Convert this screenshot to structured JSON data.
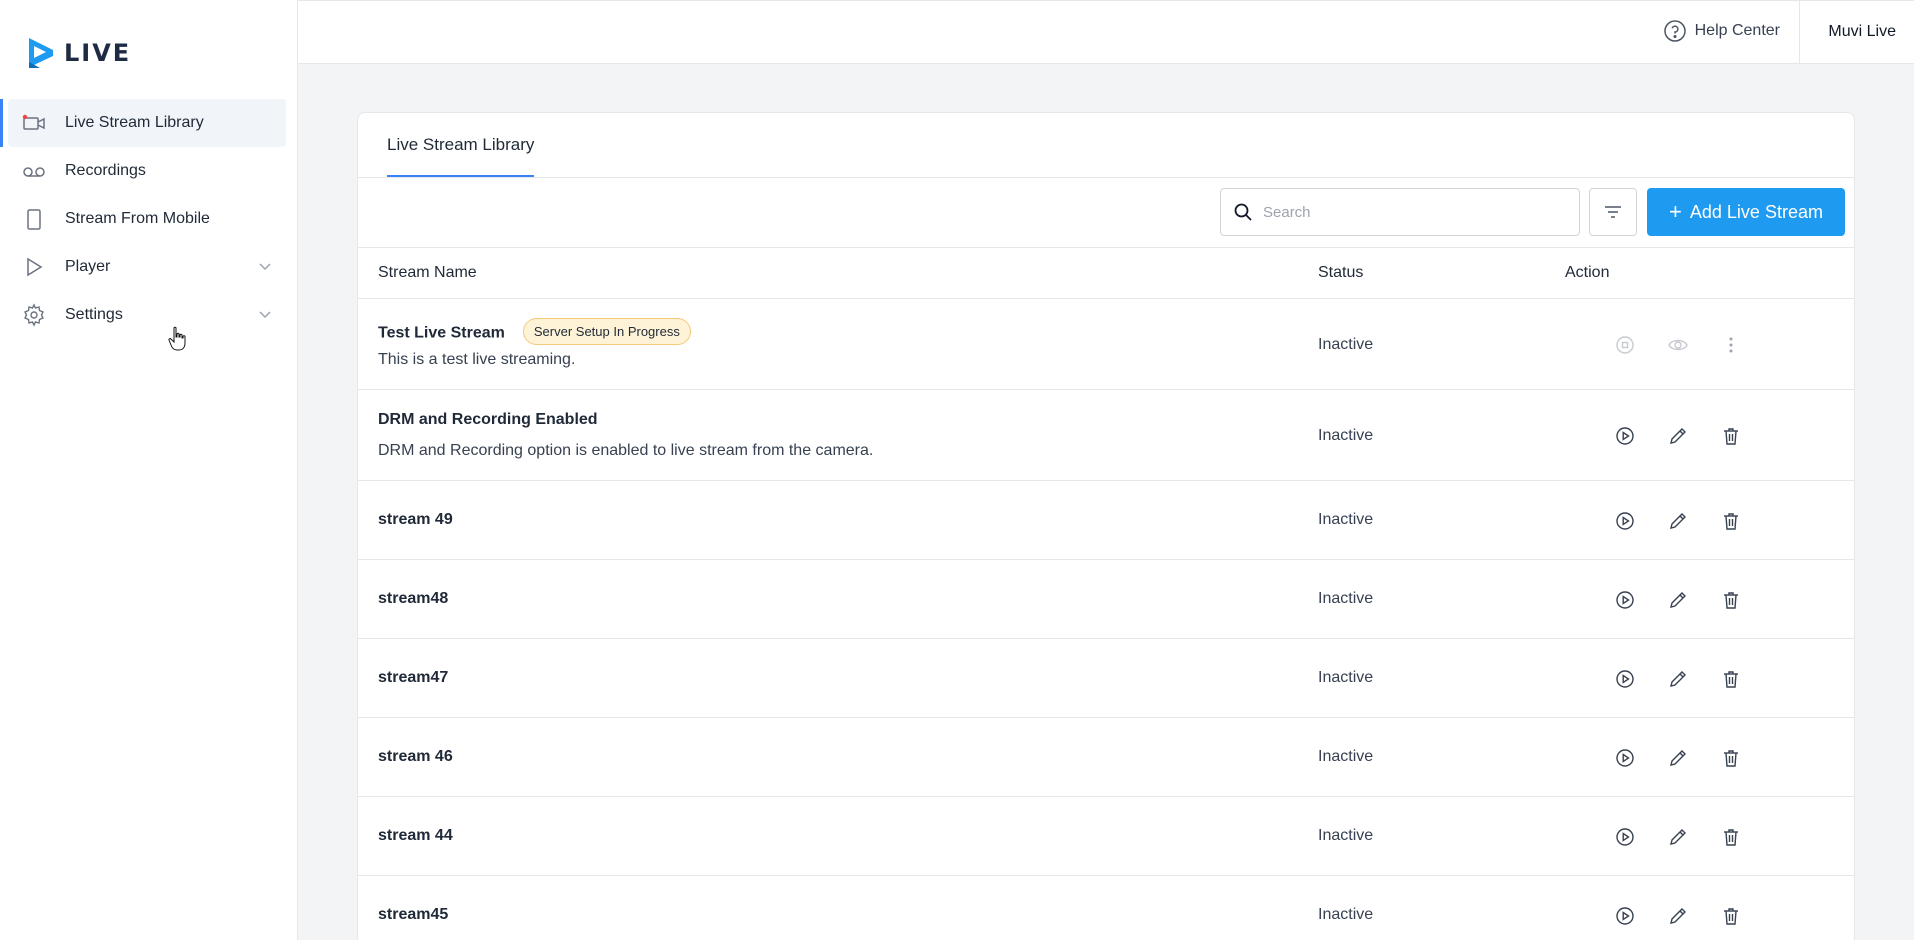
{
  "app": {
    "logo_text": "LIVE"
  },
  "sidebar": {
    "items": [
      {
        "label": "Live Stream Library",
        "icon": "camera-icon",
        "active": true
      },
      {
        "label": "Recordings",
        "icon": "voicemail-icon"
      },
      {
        "label": "Stream From Mobile",
        "icon": "mobile-icon"
      },
      {
        "label": "Player",
        "icon": "play-icon",
        "has_chevron": true
      },
      {
        "label": "Settings",
        "icon": "gear-icon",
        "has_chevron": true
      }
    ]
  },
  "header": {
    "help_label": "Help Center",
    "user_label": "Muvi Live"
  },
  "main": {
    "tab_label": "Live Stream Library",
    "search_placeholder": "Search",
    "add_button_label": "Add Live Stream",
    "columns": {
      "name": "Stream Name",
      "status": "Status",
      "action": "Action"
    },
    "rows": [
      {
        "title": "Test Live Stream",
        "badge": "Server Setup In Progress",
        "description": "This is a test live streaming.",
        "status": "Inactive"
      },
      {
        "title": "DRM and Recording Enabled",
        "description": "DRM and Recording option is enabled to live stream from the camera.",
        "status": "Inactive"
      },
      {
        "title": "stream 49",
        "status": "Inactive"
      },
      {
        "title": "stream48",
        "status": "Inactive"
      },
      {
        "title": "stream47",
        "status": "Inactive"
      },
      {
        "title": "stream 46",
        "status": "Inactive"
      },
      {
        "title": "stream 44",
        "status": "Inactive"
      },
      {
        "title": "stream45",
        "status": "Inactive"
      }
    ]
  },
  "colors": {
    "accent": "#1e9bf0",
    "active_bar": "#3b82f6",
    "badge_bg": "#fef3d6",
    "badge_border": "#f5c97a"
  }
}
